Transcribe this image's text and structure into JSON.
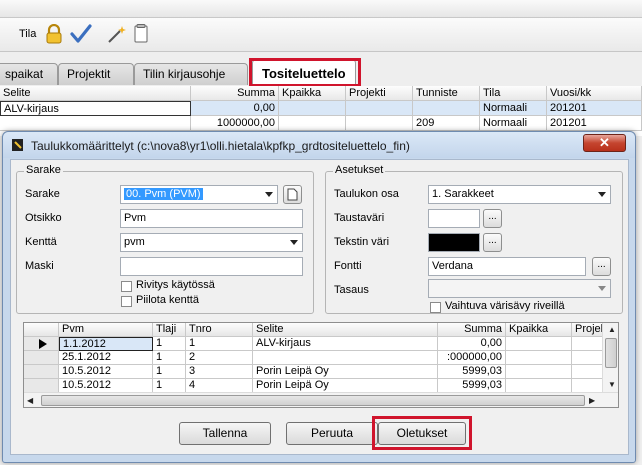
{
  "toolbar": {
    "tila_label": "Tila",
    "icons": [
      "lock-icon",
      "checkmark-icon",
      "magic-wand-icon",
      "document-icon"
    ]
  },
  "tabs": [
    {
      "label": "spaikat"
    },
    {
      "label": "Projektit"
    },
    {
      "label": "Tilin kirjausohje"
    },
    {
      "label": "Tositeluettelo",
      "active": true
    }
  ],
  "background_grid": {
    "columns": [
      "Selite",
      "Summa",
      "Kpaikka",
      "Projekti",
      "Tunniste",
      "Tila",
      "Vuosi/kk"
    ],
    "rows": [
      [
        "ALV-kirjaus",
        "0,00",
        "",
        "",
        "",
        "Normaali",
        "201201"
      ],
      [
        "",
        "1000000,00",
        "",
        "",
        "209",
        "Normaali",
        "201201"
      ]
    ]
  },
  "dialog": {
    "title": "Taulukkomäärittelyt (c:\\nova8\\yr1\\olli.hietala\\kpfkp_grdtositeluettelo_fin)",
    "close_label": "✕",
    "sarake": {
      "legend": "Sarake",
      "sarake_label": "Sarake",
      "sarake_value": "00. Pvm (PVM)",
      "otsikko_label": "Otsikko",
      "otsikko_value": "Pvm",
      "kentta_label": "Kenttä",
      "kentta_value": "pvm",
      "maski_label": "Maski",
      "maski_value": "",
      "rivitys_label": "Rivitys käytössä",
      "rivitys_checked": false,
      "piilota_label": "Piilota kenttä",
      "piilota_checked": false
    },
    "asetukset": {
      "legend": "Asetukset",
      "taulukon_osa_label": "Taulukon osa",
      "taulukon_osa_value": "1. Sarakkeet",
      "taustavari_label": "Taustaväri",
      "taustavari_color": "#ffffff",
      "tekstin_vari_label": "Tekstin väri",
      "tekstin_vari_color": "#000000",
      "fontti_label": "Fontti",
      "fontti_value": "Verdana",
      "tasaus_label": "Tasaus",
      "tasaus_value": "",
      "vaihtuva_label": "Vaihtuva värisävy riveillä",
      "vaihtuva_checked": false,
      "ellipsis": "..."
    },
    "grid": {
      "columns": [
        "Pvm",
        "Tlaji",
        "Tnro",
        "Selite",
        "Summa",
        "Kpaikka",
        "Projekt"
      ],
      "rows": [
        [
          "1.1.2012",
          "1",
          "1",
          "ALV-kirjaus",
          "0,00",
          "",
          ""
        ],
        [
          "25.1.2012",
          "1",
          "2",
          "",
          ":000000,00",
          "",
          ""
        ],
        [
          "10.5.2012",
          "1",
          "3",
          "Porin Leipä Oy",
          "5999,03",
          "",
          ""
        ],
        [
          "10.5.2012",
          "1",
          "4",
          "Porin Leipä Oy",
          "5999,03",
          "",
          ""
        ]
      ]
    },
    "buttons": {
      "tallenna": "Tallenna",
      "peruuta": "Peruuta",
      "oletukset": "Oletukset"
    }
  }
}
